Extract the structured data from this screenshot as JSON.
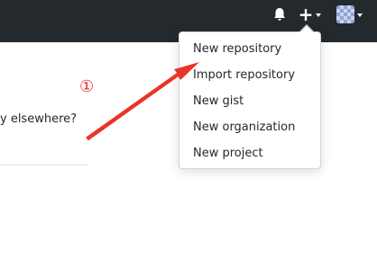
{
  "header": {
    "icons": {
      "bell": "bell-icon",
      "plus": "plus-icon",
      "caret": "caret-down-icon",
      "avatar": "avatar"
    },
    "background": "#24292e"
  },
  "page": {
    "partial_text": "y elsewhere?"
  },
  "annotation": {
    "number": "①",
    "color": "#e8342b"
  },
  "dropdown": {
    "items": [
      {
        "label": "New repository"
      },
      {
        "label": "Import repository"
      },
      {
        "label": "New gist"
      },
      {
        "label": "New organization"
      },
      {
        "label": "New project"
      }
    ]
  }
}
